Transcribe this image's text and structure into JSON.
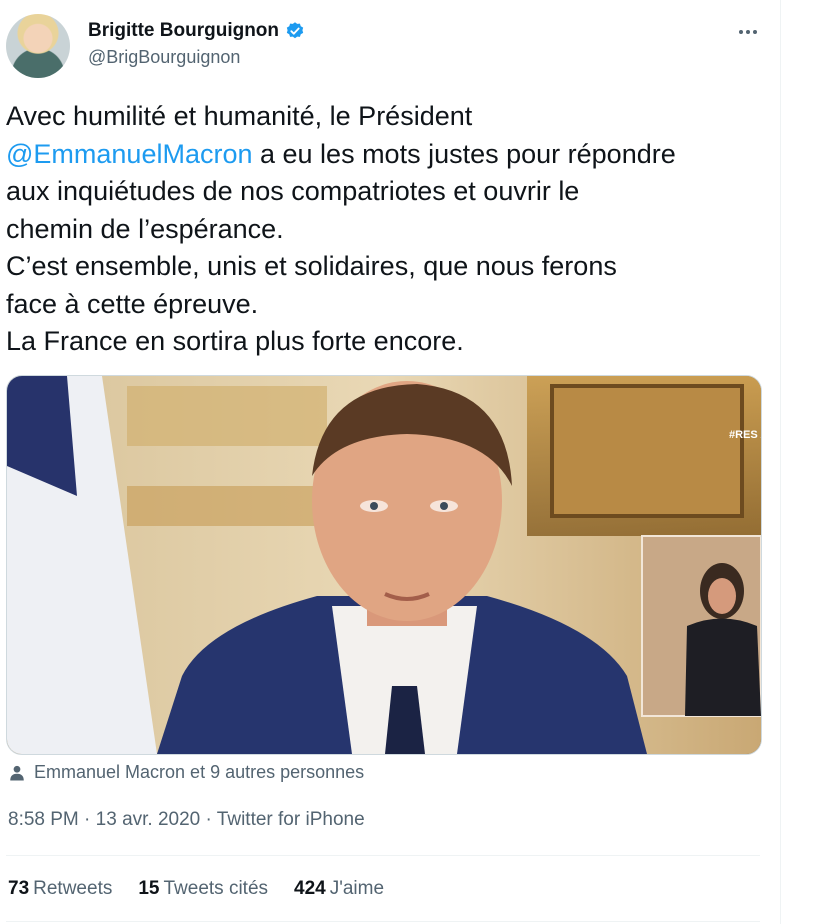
{
  "author": {
    "display_name": "Brigitte Bourguignon",
    "handle": "@BrigBourguignon"
  },
  "tweet": {
    "text_before_mention": "Avec humilité et humanité, le Président\n",
    "mention": "@EmmanuelMacron",
    "text_after_mention": " a eu les mots justes pour répondre\naux inquiétudes de nos compatriotes et ouvrir le\nchemin de l’espérance.\nC’est ensemble, unis et solidaires, que nous ferons\nface à cette épreuve.\nLa France en sortira plus forte encore.",
    "tagged": "Emmanuel Macron et 9 autres personnes",
    "time": "8:58 PM",
    "date": "13 avr. 2020",
    "source": "Twitter for iPhone",
    "separator": "·"
  },
  "media": {
    "overlay_text": "#RES A LA MA"
  },
  "stats": {
    "retweets_count": "73",
    "retweets_label": "Retweets",
    "quotes_count": "15",
    "quotes_label": "Tweets cités",
    "likes_count": "424",
    "likes_label": "J'aime"
  },
  "icons": {
    "verified": "verified-badge-icon",
    "more": "more-icon",
    "tagged": "person-icon"
  },
  "colors": {
    "accent": "#1d9bf0",
    "text": "#0f1419",
    "muted": "#536471"
  }
}
